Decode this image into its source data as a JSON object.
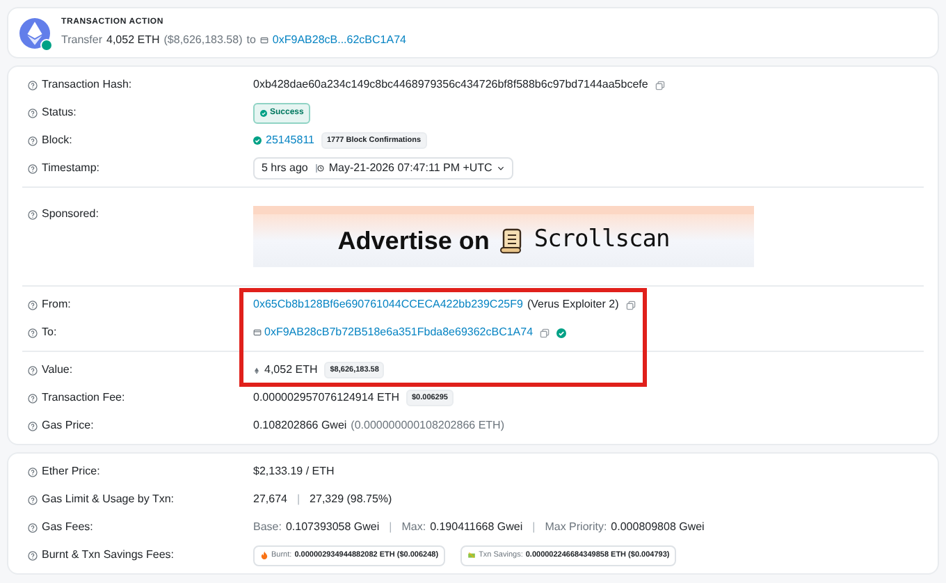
{
  "action_card": {
    "heading": "TRANSACTION ACTION",
    "prefix": "Transfer",
    "amount": "4,052 ETH",
    "usd": "($8,626,183.58)",
    "to_word": "to",
    "address": "0xF9AB28cB...62cBC1A74"
  },
  "details_card": {
    "groups": [
      {
        "rows": [
          {
            "label": "Transaction Hash:",
            "highlighted": false,
            "parts": [
              {
                "kind": "text",
                "text": "0xb428dae60a234c149c8bc4468979356c434726bf8f588b6c97bd7144aa5bcefe"
              },
              {
                "kind": "copy"
              }
            ]
          },
          {
            "label": "Status:",
            "highlighted": false,
            "parts": [
              {
                "kind": "success_badge",
                "text": "Success"
              }
            ]
          },
          {
            "label": "Block:",
            "highlighted": false,
            "parts": [
              {
                "kind": "block_link",
                "text": "25145811"
              },
              {
                "kind": "badge",
                "text": "1777 Block Confirmations"
              }
            ]
          },
          {
            "label": "Timestamp:",
            "highlighted": false,
            "parts": [
              {
                "kind": "time_box",
                "age": "5 hrs ago",
                "time": "May-21-2026 07:47:11 PM +UTC"
              }
            ]
          }
        ]
      },
      {
        "rows": [
          {
            "label": "Sponsored:",
            "highlighted": false,
            "parts": [
              {
                "kind": "ad",
                "headline": "Advertise on",
                "brand": "Scrollscan"
              }
            ]
          }
        ]
      },
      {
        "rows": [
          {
            "label": "From:",
            "highlighted": true,
            "parts": [
              {
                "kind": "link",
                "text": "0x65Cb8b128Bf6e690761044CCECA422bb239C25F9"
              },
              {
                "kind": "text",
                "text": "(Verus Exploiter 2)"
              },
              {
                "kind": "copy"
              }
            ]
          },
          {
            "label": "To:",
            "highlighted": true,
            "parts": [
              {
                "kind": "contract_link",
                "text": "0xF9AB28cB7b72B518e6a351Fbda8e69362cBC1A74"
              },
              {
                "kind": "copy"
              },
              {
                "kind": "verified"
              }
            ]
          }
        ]
      },
      {
        "rows": [
          {
            "label": "Value:",
            "highlighted": true,
            "parts": [
              {
                "kind": "eth_amount",
                "text": "4,052 ETH"
              },
              {
                "kind": "badge",
                "text": "$8,626,183.58"
              }
            ]
          },
          {
            "label": "Transaction Fee:",
            "highlighted": false,
            "parts": [
              {
                "kind": "text",
                "text": "0.000002957076124914 ETH"
              },
              {
                "kind": "badge",
                "text": "$0.006295"
              }
            ]
          },
          {
            "label": "Gas Price:",
            "highlighted": false,
            "parts": [
              {
                "kind": "text",
                "text": "0.108202866 Gwei"
              },
              {
                "kind": "muted",
                "text": "(0.000000000108202866 ETH)"
              }
            ]
          }
        ]
      }
    ]
  },
  "fees_card": {
    "groups": [
      {
        "rows": [
          {
            "label": "Ether Price:",
            "highlighted": false,
            "parts": [
              {
                "kind": "text",
                "text": "$2,133.19 / ETH"
              }
            ]
          },
          {
            "label": "Gas Limit & Usage by Txn:",
            "highlighted": false,
            "parts": [
              {
                "kind": "text",
                "text": "27,674"
              },
              {
                "kind": "sep",
                "text": "|"
              },
              {
                "kind": "text",
                "text": "27,329 (98.75%)"
              }
            ]
          },
          {
            "label": "Gas Fees:",
            "highlighted": false,
            "parts": [
              {
                "kind": "muted",
                "text": "Base:"
              },
              {
                "kind": "text",
                "text": "0.107393058 Gwei"
              },
              {
                "kind": "sep",
                "text": "|"
              },
              {
                "kind": "muted",
                "text": "Max:"
              },
              {
                "kind": "text",
                "text": "0.190411668 Gwei"
              },
              {
                "kind": "sep",
                "text": "|"
              },
              {
                "kind": "muted",
                "text": "Max Priority:"
              },
              {
                "kind": "text",
                "text": "0.000809808 Gwei"
              }
            ]
          },
          {
            "label": "Burnt & Txn Savings Fees:",
            "highlighted": false,
            "parts": [
              {
                "kind": "burnt_badge",
                "label": "Burnt:",
                "text": "0.000002934944882082 ETH ($0.006248)"
              },
              {
                "kind": "savings_badge",
                "label": "Txn Savings:",
                "text": "0.000002246684349858 ETH ($0.004793)"
              }
            ]
          }
        ]
      }
    ]
  }
}
